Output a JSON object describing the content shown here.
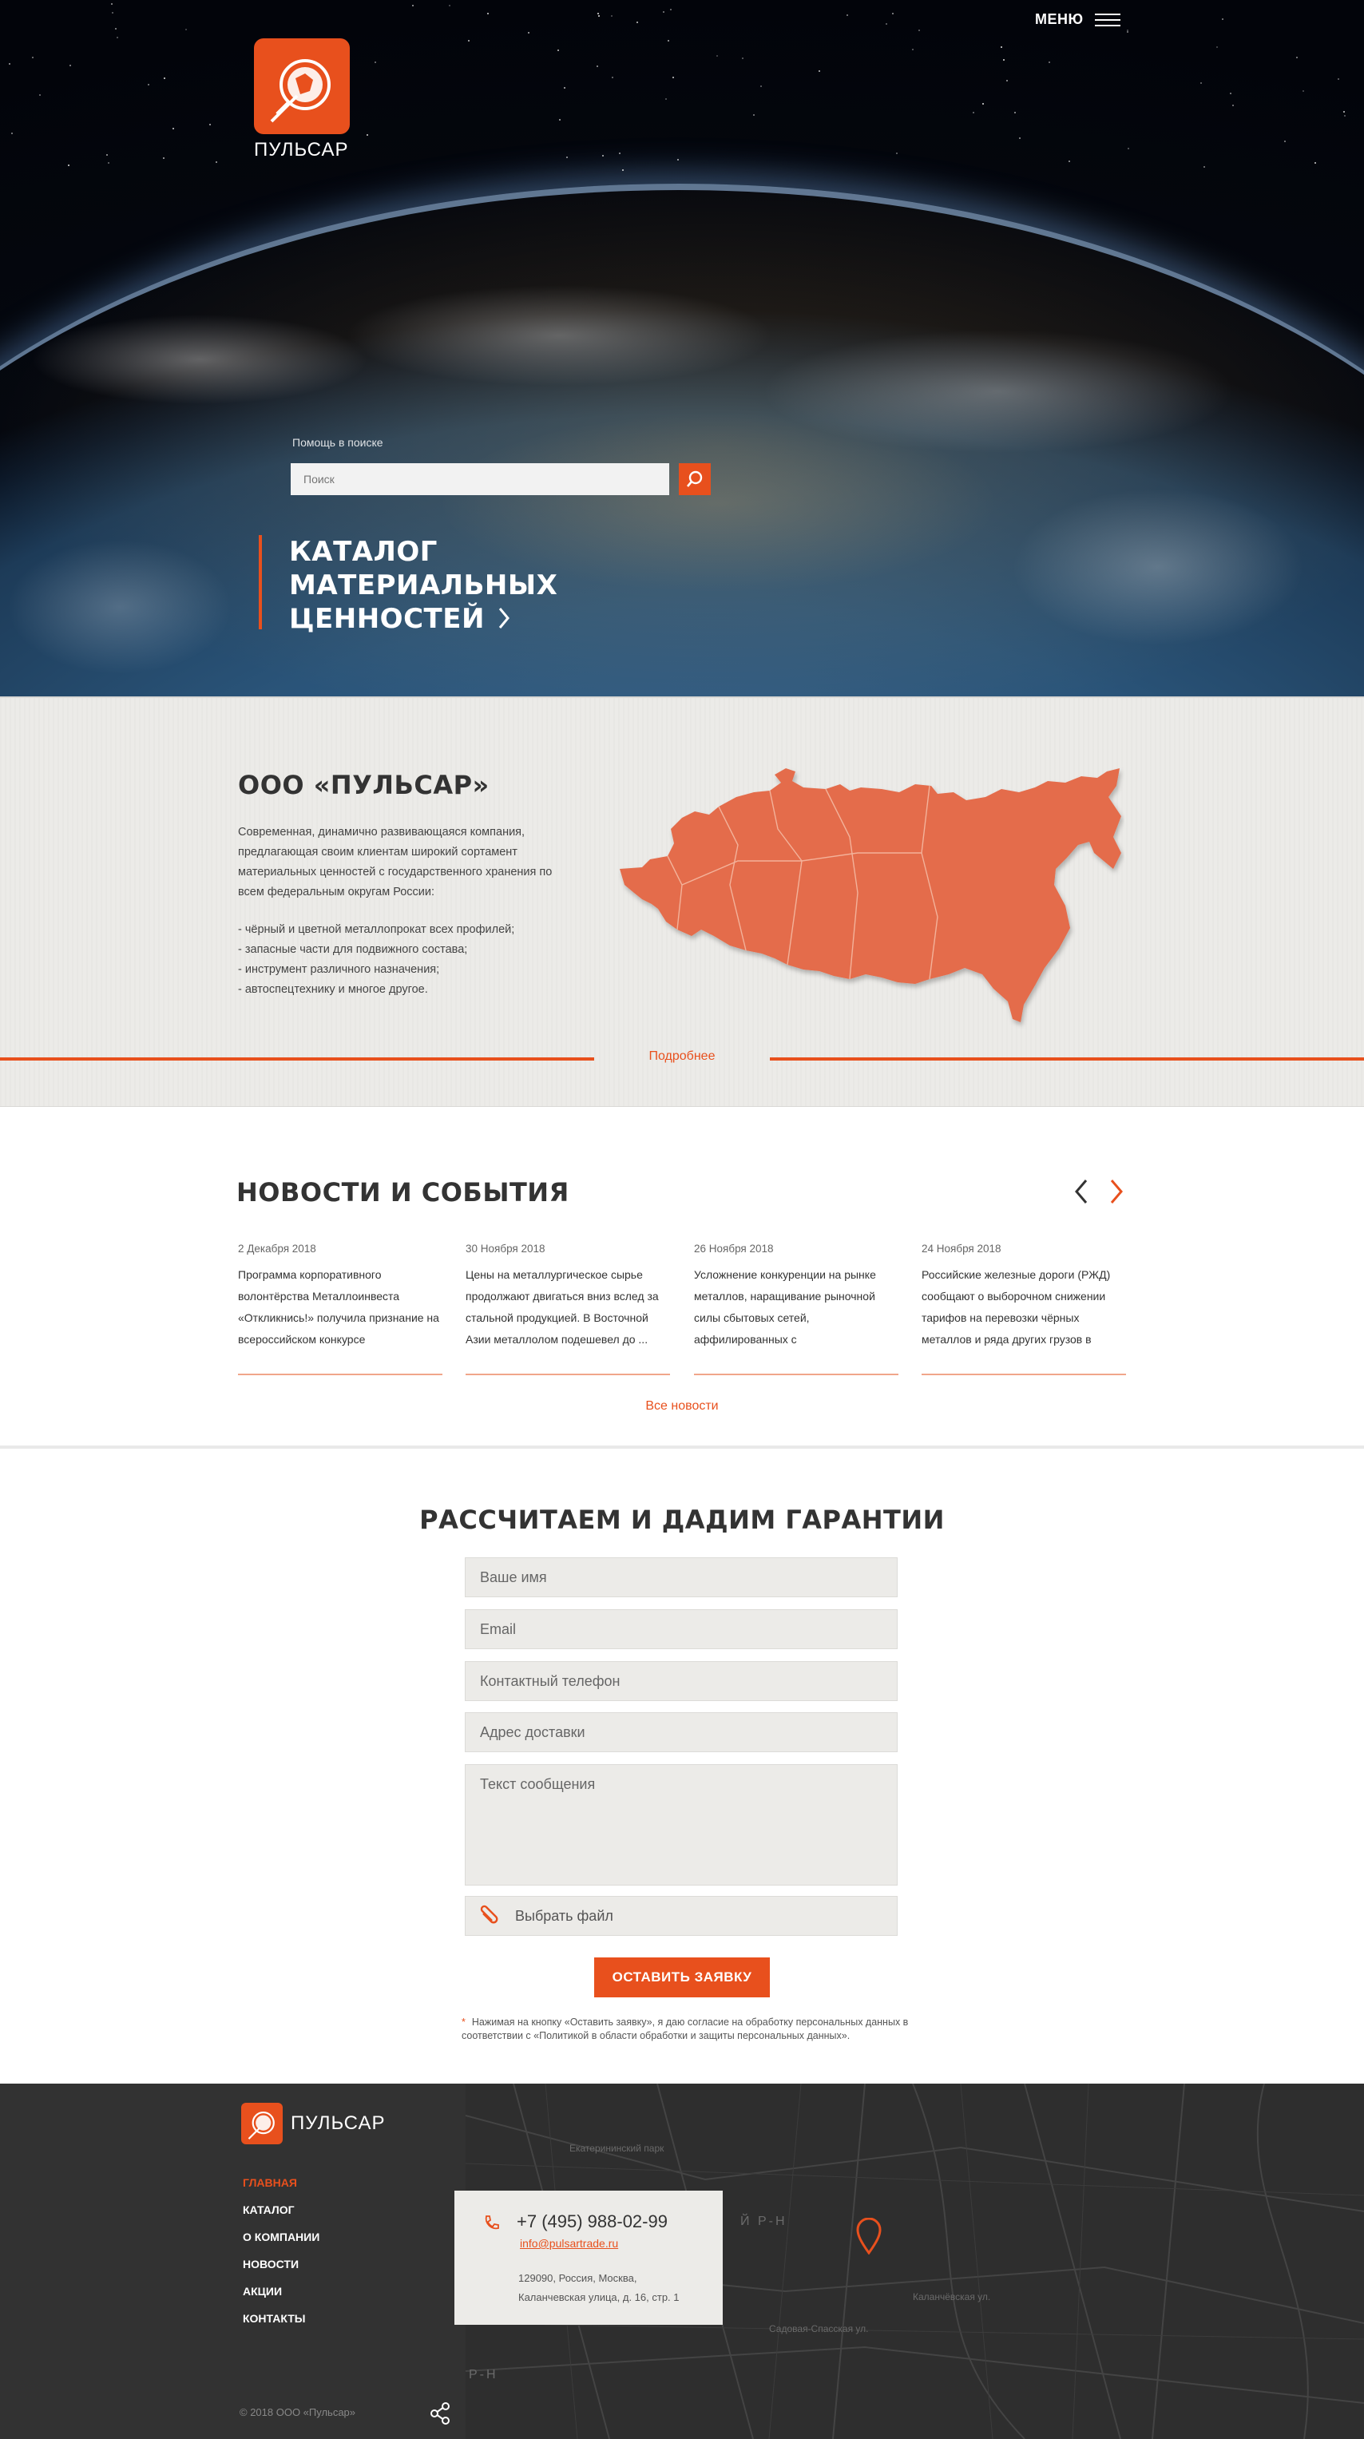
{
  "header": {
    "menu_label": "МЕНЮ",
    "brand": "ПУЛЬСАР"
  },
  "search": {
    "help": "Помощь в поиске",
    "placeholder": "Поиск"
  },
  "catalog": {
    "lines": [
      "КАТАЛОГ",
      "МАТЕРИАЛЬНЫХ",
      "ЦЕННОСТЕЙ"
    ]
  },
  "about": {
    "title": "ООО «ПУЛЬСАР»",
    "description": "Современная, динамично развивающаяся компания, предлагающая своим клиентам широкий сортамент материальных ценностей с государственного хранения по всем федеральным округам России:",
    "items": [
      "- чёрный и цветной металлопрокат всех профилей;",
      "- запасные части для подвижного состава;",
      "- инструмент различного назначения;",
      "- автоспецтехнику и многое другое."
    ],
    "more_label": "Подробнее",
    "map_color": "#e46c4c"
  },
  "news": {
    "title": "НОВОСТИ И СОБЫТИЯ",
    "all_label": "Все новости",
    "items": [
      {
        "date": "2 Декабря 2018",
        "text": "Программа корпоративного волонтёрства Металлоинвеста «Откликнись!» получила признание на всероссийском конкурсе"
      },
      {
        "date": "30 Ноября 2018",
        "text": "Цены на металлургическое сырье продолжают двигаться вниз вслед за стальной продукцией. В Восточной Азии металлолом подешевел до ..."
      },
      {
        "date": "26 Ноября 2018",
        "text": "Усложнение конкуренции на рынке металлов, наращивание рыночной силы сбытовых сетей, аффилированных с"
      },
      {
        "date": "24 Ноября 2018",
        "text": "Российские железные дороги (РЖД) сообщают о выборочном снижении тарифов на перевозки чёрных металлов и ряда других грузов в"
      }
    ]
  },
  "form": {
    "title": "РАССЧИТАЕМ И ДАДИМ ГАРАНТИИ",
    "name_placeholder": "Ваше имя",
    "email_placeholder": "Email",
    "phone_placeholder": "Контактный телефон",
    "address_placeholder": "Адрес доставки",
    "message_placeholder": "Текст сообщения",
    "file_label": "Выбрать файл",
    "submit_label": "ОСТАВИТЬ ЗАЯВКУ",
    "consent": "Нажимая на кнопку «Оставить заявку», я даю согласие на обработку персональных данных в соответствии с «Политикой в области обработки и защиты персональных данных».",
    "consent_mark": "*"
  },
  "footer": {
    "brand": "ПУЛЬСАР",
    "nav": [
      "ГЛАВНАЯ",
      "КАТАЛОГ",
      "О КОМПАНИИ",
      "НОВОСТИ",
      "АКЦИИ",
      "КОНТАКТЫ"
    ],
    "phone": "+7 (495) 988-02-99",
    "email": "info@pulsartrade.ru",
    "address_line1": "129090, Россия, Москва,",
    "address_line2": "Каланчевская улица, д. 16, стр. 1",
    "copyright": "© 2018 ООО «Пульсар»",
    "map_labels": [
      "Екатерининский парк",
      "Й Р-Н",
      "Р-Н",
      "Садовая-Спасская ул.",
      "Каланчёвская ул."
    ]
  },
  "colors": {
    "accent": "#e8501d",
    "dark": "#323232",
    "light_bg": "#ecebe8"
  }
}
